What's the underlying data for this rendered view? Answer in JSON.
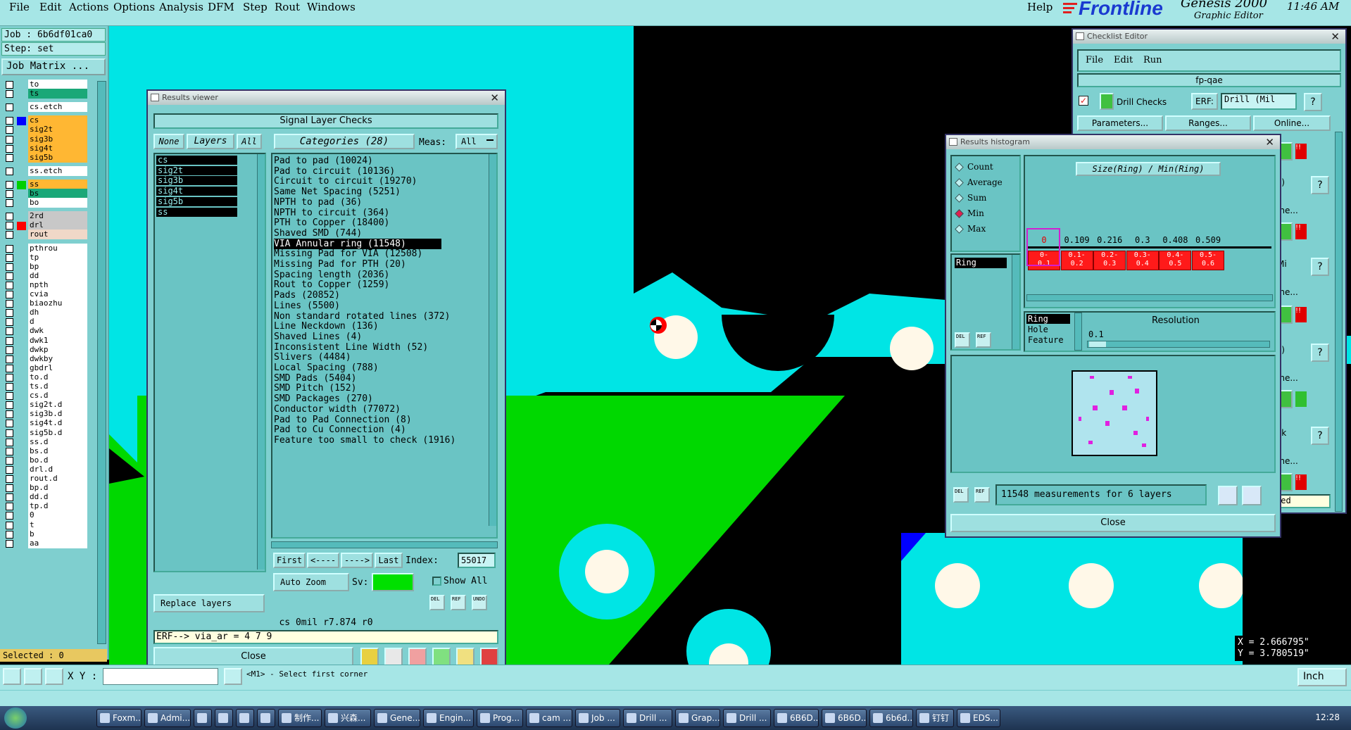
{
  "menubar": {
    "items": [
      "File",
      "Edit",
      "Actions",
      "Options",
      "Analysis",
      "DFM",
      "Step",
      "Rout",
      "Windows"
    ],
    "help": "Help",
    "brand": "Frontline",
    "product": "Genesis 2000",
    "product_sub": "Graphic Editor",
    "clock": "11:46 AM"
  },
  "left_panel": {
    "job": "Job : 6b6df01ca0",
    "step": "Step: set",
    "job_matrix": "Job Matrix ...",
    "layers": [
      {
        "name": "to",
        "color": "#ffffff"
      },
      {
        "name": "ts",
        "color": "#1aa878"
      },
      {
        "name": "cs.etch",
        "color": "#ffffff"
      },
      {
        "name": "cs",
        "color": "#ffb733"
      },
      {
        "name": "sig2t",
        "color": "#ffb733"
      },
      {
        "name": "sig3b",
        "color": "#ffb733"
      },
      {
        "name": "sig4t",
        "color": "#ffb733"
      },
      {
        "name": "sig5b",
        "color": "#ffb733"
      },
      {
        "name": "ss.etch",
        "color": "#ffffff"
      },
      {
        "name": "ss",
        "color": "#ffb733"
      },
      {
        "name": "bs",
        "color": "#1aa878"
      },
      {
        "name": "bo",
        "color": "#ffffff"
      },
      {
        "name": "2rd",
        "color": "#c8c8c8"
      },
      {
        "name": "drl",
        "color": "#c8c8c8"
      },
      {
        "name": "rout",
        "color": "#f0d8c8"
      },
      {
        "name": "pthrou",
        "color": "#ffffff"
      },
      {
        "name": "tp",
        "color": "#ffffff"
      },
      {
        "name": "bp",
        "color": "#ffffff"
      },
      {
        "name": "dd",
        "color": "#ffffff"
      },
      {
        "name": "npth",
        "color": "#ffffff"
      },
      {
        "name": "cvia",
        "color": "#ffffff"
      },
      {
        "name": "biaozhu",
        "color": "#ffffff"
      },
      {
        "name": "dh",
        "color": "#ffffff"
      },
      {
        "name": "d",
        "color": "#ffffff"
      },
      {
        "name": "dwk",
        "color": "#ffffff"
      },
      {
        "name": "dwk1",
        "color": "#ffffff"
      },
      {
        "name": "dwkp",
        "color": "#ffffff"
      },
      {
        "name": "dwkby",
        "color": "#ffffff"
      },
      {
        "name": "gbdrl",
        "color": "#ffffff"
      },
      {
        "name": "to.d",
        "color": "#ffffff"
      },
      {
        "name": "ts.d",
        "color": "#ffffff"
      },
      {
        "name": "cs.d",
        "color": "#ffffff"
      },
      {
        "name": "sig2t.d",
        "color": "#ffffff"
      },
      {
        "name": "sig3b.d",
        "color": "#ffffff"
      },
      {
        "name": "sig4t.d",
        "color": "#ffffff"
      },
      {
        "name": "sig5b.d",
        "color": "#ffffff"
      },
      {
        "name": "ss.d",
        "color": "#ffffff"
      },
      {
        "name": "bs.d",
        "color": "#ffffff"
      },
      {
        "name": "bo.d",
        "color": "#ffffff"
      },
      {
        "name": "drl.d",
        "color": "#ffffff"
      },
      {
        "name": "rout.d",
        "color": "#ffffff"
      },
      {
        "name": "bp.d",
        "color": "#ffffff"
      },
      {
        "name": "dd.d",
        "color": "#ffffff"
      },
      {
        "name": "tp.d",
        "color": "#ffffff"
      },
      {
        "name": "0",
        "color": "#ffffff"
      },
      {
        "name": "t",
        "color": "#ffffff"
      },
      {
        "name": "b",
        "color": "#ffffff"
      },
      {
        "name": "aa",
        "color": "#ffffff"
      }
    ],
    "selected": "Selected : 0"
  },
  "results_viewer": {
    "title": "Results viewer",
    "header": "Signal Layer Checks",
    "none_btn": "None",
    "layers_btn": "Layers",
    "all_btn": "All",
    "categories_label": "Categories (28)",
    "meas_label": "Meas:",
    "meas_value": "All",
    "layers": [
      "cs",
      "sig2t",
      "sig3b",
      "sig4t",
      "sig5b",
      "ss"
    ],
    "categories": [
      "Pad to pad (10024)",
      "Pad to circuit (10136)",
      "Circuit to circuit (19270)",
      "Same Net Spacing (5251)",
      "NPTH to pad (36)",
      "NPTH to circuit (364)",
      "PTH to Copper (18400)",
      "Shaved SMD (744)",
      "VIA Annular ring (11548)",
      "Missing Pad for VIA (12508)",
      "Missing Pad for PTH (20)",
      "Spacing length (2036)",
      "Rout to Copper (1259)",
      "Pads (20852)",
      "Lines (5500)",
      "Non standard rotated lines (372)",
      "Line Neckdown (136)",
      "Shaved Lines (4)",
      "Inconsistent Line Width (52)",
      "Slivers (4484)",
      "Local Spacing (788)",
      "SMD Pads (5404)",
      "SMD Pitch (152)",
      "SMD Packages (270)",
      "Conductor width (77072)",
      "Pad to Pad Connection (8)",
      "Pad to Cu Connection (4)",
      "Feature too small to check (1916)"
    ],
    "selected_index": 8,
    "first": "First",
    "prev": "<----",
    "next": "---->",
    "last": "Last",
    "index_label": "Index:",
    "index_value": "55017",
    "auto_zoom": "Auto Zoom",
    "sv_label": "Sv:",
    "show_all": "Show All",
    "replace_layers": "Replace layers",
    "status": "cs 0mil   r7.874  r0",
    "erf": "ERF--> via_ar = 4 7 9",
    "close": "Close",
    "del": "DEL",
    "ref": "REF",
    "undo": "UNDO"
  },
  "checklist_editor": {
    "title": "Checklist Editor",
    "menu": [
      "File",
      "Edit",
      "Run"
    ],
    "name": "fp-qae",
    "check_name": "Drill Checks",
    "erf_label": "ERF:",
    "erf_value": "Drill (Mil",
    "parameters": "Parameters...",
    "ranges": "Ranges...",
    "online": "Online...",
    "frag_s": "s)",
    "frag_ine": "ine...",
    "frag_mi": "Mi",
    "frag_sk": "sk",
    "frag_sed": "sed",
    "help": "?"
  },
  "histogram": {
    "title": "Results histogram",
    "modes": [
      "Count",
      "Average",
      "Sum",
      "Min",
      "Max"
    ],
    "selected_mode": "Min",
    "chart_title": "Size(Ring) / Min(Ring)",
    "row_label": "Ring",
    "measure_options": [
      "Ring",
      "Hole",
      "Feature"
    ],
    "resolution_label": "Resolution",
    "resolution_value": "0.1",
    "measurements": "11548 measurements for 6 layers",
    "close": "Close",
    "del": "DEL",
    "ref": "REF"
  },
  "chart_data": {
    "type": "table",
    "title": "Size(Ring) / Min(Ring)",
    "categories": [
      "0-0.1",
      "0.1-0.2",
      "0.2-0.3",
      "0.3-0.4",
      "0.4-0.5",
      "0.5-0.6"
    ],
    "bin_labels_top": [
      "0-",
      "0.1-",
      "0.2-",
      "0.3-",
      "0.4-",
      "0.5-"
    ],
    "bin_labels_bottom": [
      "0.1",
      "0.2",
      "0.3",
      "0.4",
      "0.5",
      "0.6"
    ],
    "values": [
      "0",
      "0.109",
      "0.216",
      "0.3",
      "0.408",
      "0.509"
    ],
    "colors": {
      "bin": "#ff1a1a",
      "selected_outline": "#d020d0"
    }
  },
  "bottom": {
    "xy_label": "X Y :",
    "message": "<M1> - Select first corner",
    "units": "Inch",
    "coord_x": "X = 2.666795\"",
    "coord_y": "Y = 3.780519\""
  },
  "taskbar": {
    "tasks": [
      "Foxm...",
      "Admi...",
      "",
      "",
      "",
      "",
      "制作...",
      "兴森...",
      "Gene...",
      "Engin...",
      "Prog...",
      "cam ...",
      "Job ...",
      "Drill ...",
      "Grap...",
      "Drill ...",
      "6B6D...",
      "6B6D...",
      "6b6d...",
      "钉钉",
      "EDS..."
    ],
    "clock": "12:28"
  },
  "colors": {
    "cyan": "#00e5e5",
    "green": "#00d800",
    "black": "#000000",
    "pad": "#fff8e8",
    "panel": "#7fd0d0"
  }
}
